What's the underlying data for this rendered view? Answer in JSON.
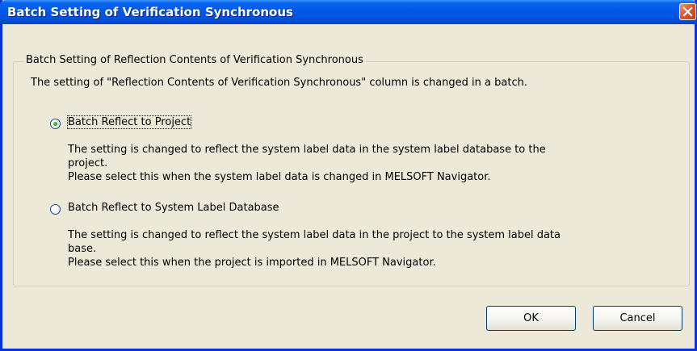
{
  "window": {
    "title": "Batch Setting of Verification Synchronous"
  },
  "group": {
    "legend": "Batch Setting of Reflection Contents of Verification Synchronous",
    "intro": "The setting of \"Reflection Contents of Verification Synchronous\" column is changed in a batch."
  },
  "options": [
    {
      "label": "Batch Reflect to Project",
      "selected": true,
      "desc_line1": "The setting is changed to reflect the system label data in the system label database to the",
      "desc_line2": "project.",
      "desc_line3": "Please select this when the system label data is changed in MELSOFT Navigator."
    },
    {
      "label": "Batch Reflect to System Label Database",
      "selected": false,
      "desc_line1": "The setting is changed to reflect the system label data in the project to the system label data",
      "desc_line2": "base.",
      "desc_line3": "Please select this when the project is imported in MELSOFT Navigator."
    }
  ],
  "buttons": {
    "ok": "OK",
    "cancel": "Cancel"
  },
  "icons": {
    "close": "close-icon"
  },
  "colors": {
    "titlebar": "#0054e3",
    "face": "#ece9d8",
    "close": "#e2552c",
    "radio_selected": "#21a121"
  }
}
